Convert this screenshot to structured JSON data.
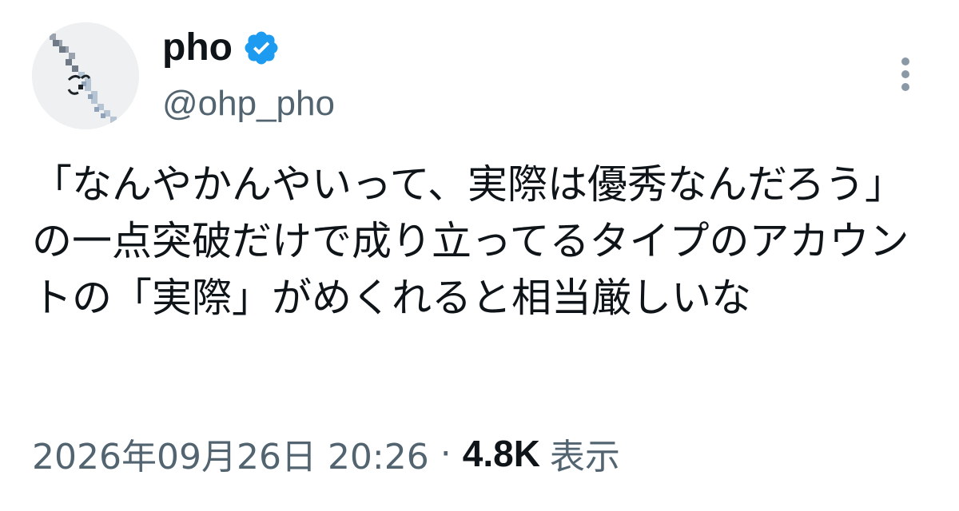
{
  "author": {
    "display_name": "pho",
    "handle": "@ohp_pho",
    "verified": true
  },
  "tweet": {
    "text": "「なんやかんやいって、実際は優秀なんだろう」の一点突破だけで成り立ってるタイプのアカウントの「実際」がめくれると相当厳しいな"
  },
  "meta": {
    "timestamp": "2026年09月26日 20:26",
    "separator": "·",
    "views_count": "4.8K",
    "views_label": "表示"
  },
  "colors": {
    "text_primary": "#0f1419",
    "text_secondary": "#536471",
    "verified_blue": "#1d9bf0",
    "background": "#ffffff"
  },
  "icons": {
    "verified": "verified-badge-icon",
    "more": "more-vertical-icon"
  }
}
